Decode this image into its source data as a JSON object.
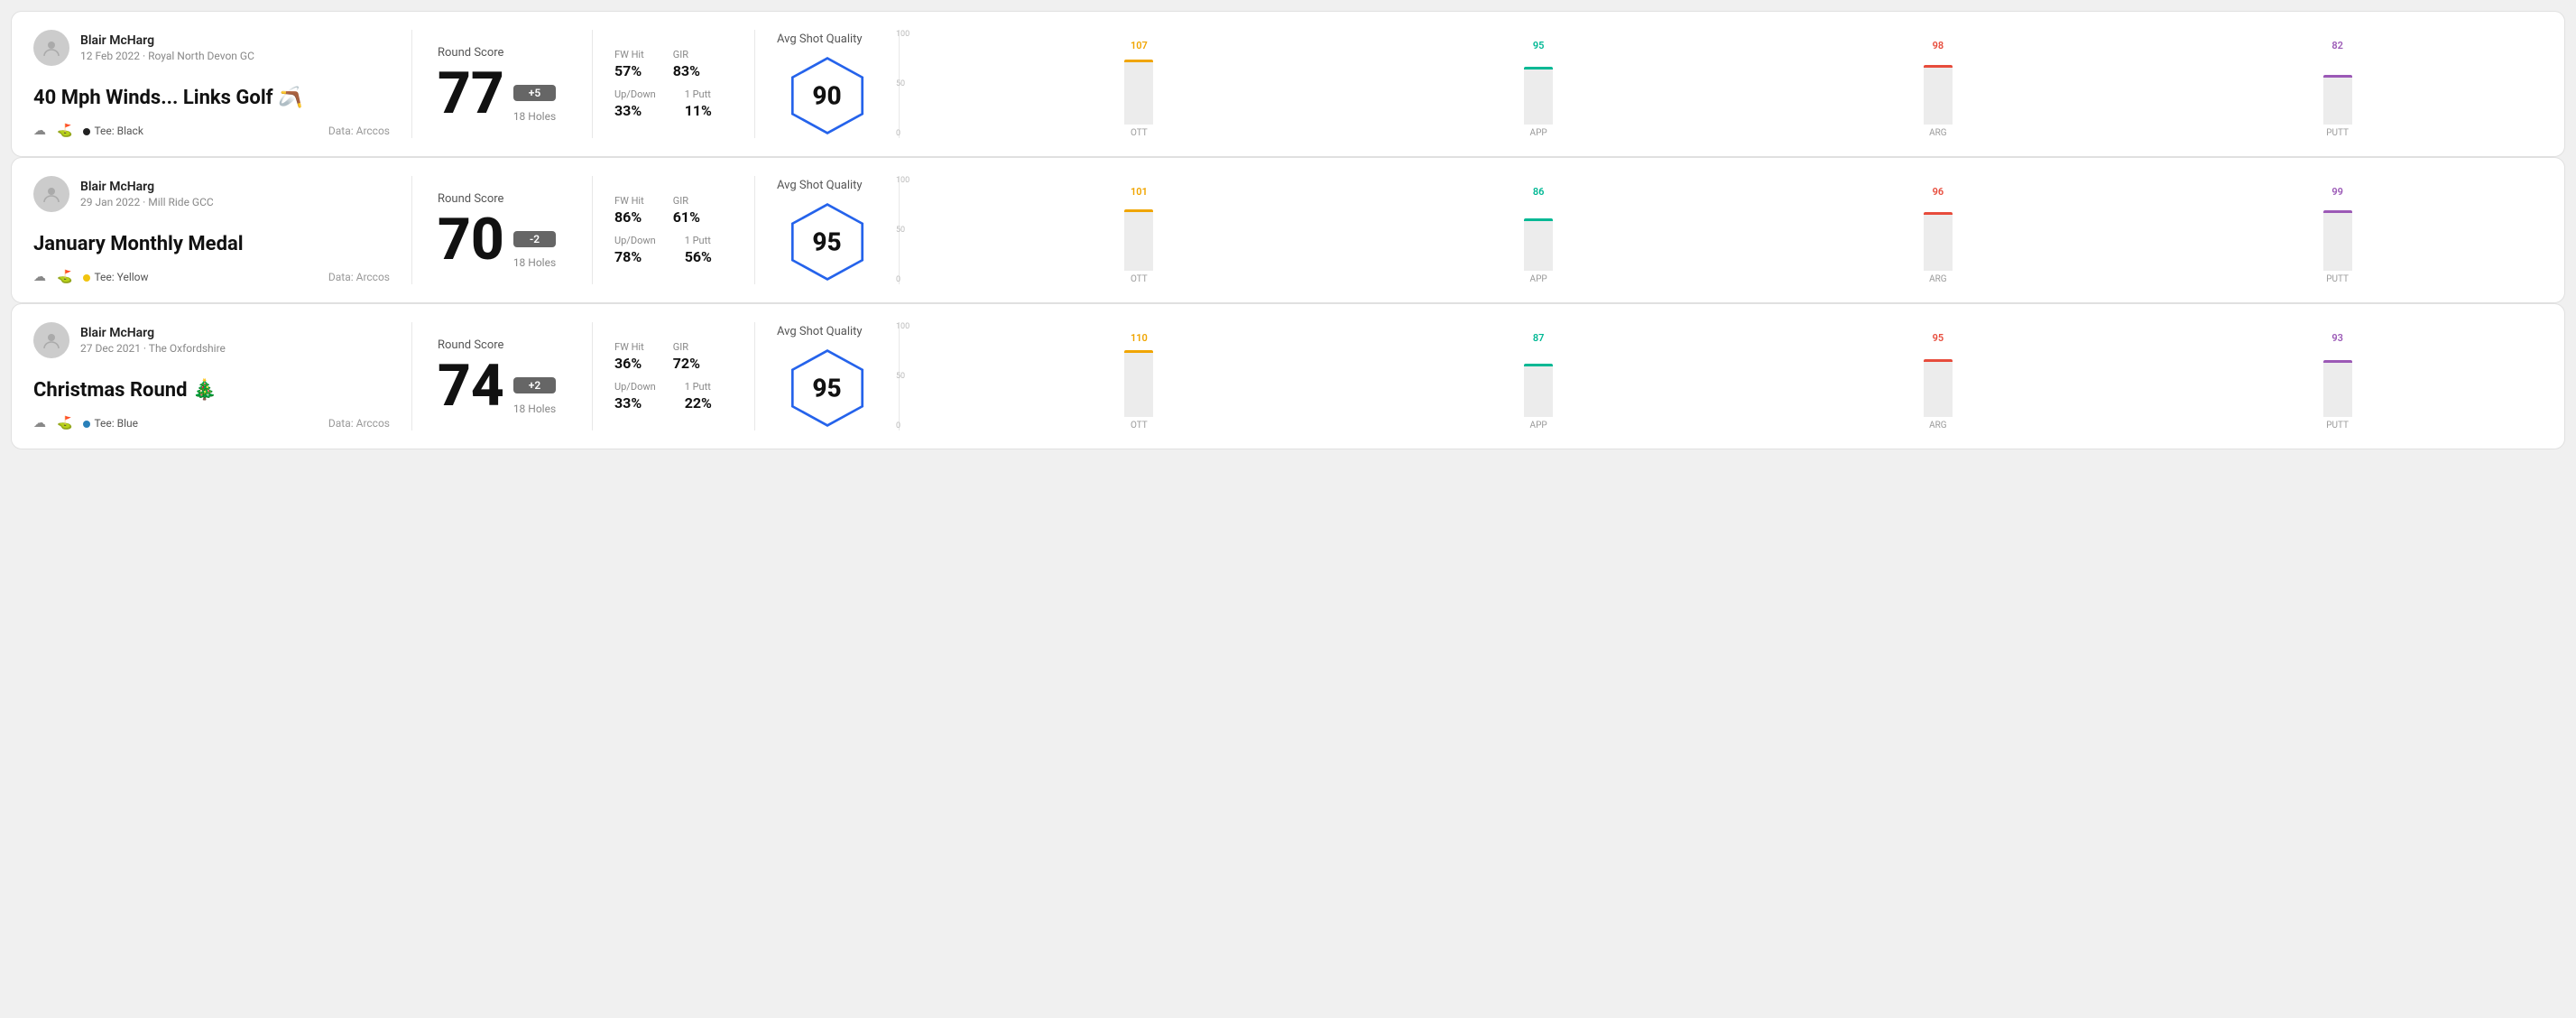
{
  "rounds": [
    {
      "id": "round-1",
      "user": {
        "name": "Blair McHarg",
        "date": "12 Feb 2022",
        "course": "Royal North Devon GC"
      },
      "title": "40 Mph Winds... Links Golf 🪃",
      "tee": "Black",
      "teeColor": "#222222",
      "dataSource": "Data: Arccos",
      "score": {
        "label": "Round Score",
        "value": "77",
        "badge": "+5",
        "badgeType": "over",
        "holes": "18 Holes"
      },
      "stats": {
        "fwHitLabel": "FW Hit",
        "fwHitValue": "57%",
        "girLabel": "GIR",
        "girValue": "83%",
        "upDownLabel": "Up/Down",
        "upDownValue": "33%",
        "onePuttLabel": "1 Putt",
        "onePuttValue": "11%"
      },
      "quality": {
        "label": "Avg Shot Quality",
        "value": "90"
      },
      "chart": {
        "bars": [
          {
            "label": "OTT",
            "value": 107,
            "color": "#f0a500",
            "heightPct": 72
          },
          {
            "label": "APP",
            "value": 95,
            "color": "#00b894",
            "heightPct": 64
          },
          {
            "label": "ARG",
            "value": 98,
            "color": "#e74c3c",
            "heightPct": 66
          },
          {
            "label": "PUTT",
            "value": 82,
            "color": "#9b59b6",
            "heightPct": 55
          }
        ],
        "yLabels": [
          "100",
          "50",
          "0"
        ]
      }
    },
    {
      "id": "round-2",
      "user": {
        "name": "Blair McHarg",
        "date": "29 Jan 2022",
        "course": "Mill Ride GCC"
      },
      "title": "January Monthly Medal",
      "tee": "Yellow",
      "teeColor": "#f1c40f",
      "dataSource": "Data: Arccos",
      "score": {
        "label": "Round Score",
        "value": "70",
        "badge": "-2",
        "badgeType": "under",
        "holes": "18 Holes"
      },
      "stats": {
        "fwHitLabel": "FW Hit",
        "fwHitValue": "86%",
        "girLabel": "GIR",
        "girValue": "61%",
        "upDownLabel": "Up/Down",
        "upDownValue": "78%",
        "onePuttLabel": "1 Putt",
        "onePuttValue": "56%"
      },
      "quality": {
        "label": "Avg Shot Quality",
        "value": "95"
      },
      "chart": {
        "bars": [
          {
            "label": "OTT",
            "value": 101,
            "color": "#f0a500",
            "heightPct": 68
          },
          {
            "label": "APP",
            "value": 86,
            "color": "#00b894",
            "heightPct": 58
          },
          {
            "label": "ARG",
            "value": 96,
            "color": "#e74c3c",
            "heightPct": 65
          },
          {
            "label": "PUTT",
            "value": 99,
            "color": "#9b59b6",
            "heightPct": 67
          }
        ],
        "yLabels": [
          "100",
          "50",
          "0"
        ]
      }
    },
    {
      "id": "round-3",
      "user": {
        "name": "Blair McHarg",
        "date": "27 Dec 2021",
        "course": "The Oxfordshire"
      },
      "title": "Christmas Round 🎄",
      "tee": "Blue",
      "teeColor": "#2980b9",
      "dataSource": "Data: Arccos",
      "score": {
        "label": "Round Score",
        "value": "74",
        "badge": "+2",
        "badgeType": "over",
        "holes": "18 Holes"
      },
      "stats": {
        "fwHitLabel": "FW Hit",
        "fwHitValue": "36%",
        "girLabel": "GIR",
        "girValue": "72%",
        "upDownLabel": "Up/Down",
        "upDownValue": "33%",
        "onePuttLabel": "1 Putt",
        "onePuttValue": "22%"
      },
      "quality": {
        "label": "Avg Shot Quality",
        "value": "95"
      },
      "chart": {
        "bars": [
          {
            "label": "OTT",
            "value": 110,
            "color": "#f0a500",
            "heightPct": 74
          },
          {
            "label": "APP",
            "value": 87,
            "color": "#00b894",
            "heightPct": 59
          },
          {
            "label": "ARG",
            "value": 95,
            "color": "#e74c3c",
            "heightPct": 64
          },
          {
            "label": "PUTT",
            "value": 93,
            "color": "#9b59b6",
            "heightPct": 63
          }
        ],
        "yLabels": [
          "100",
          "50",
          "0"
        ]
      }
    }
  ]
}
